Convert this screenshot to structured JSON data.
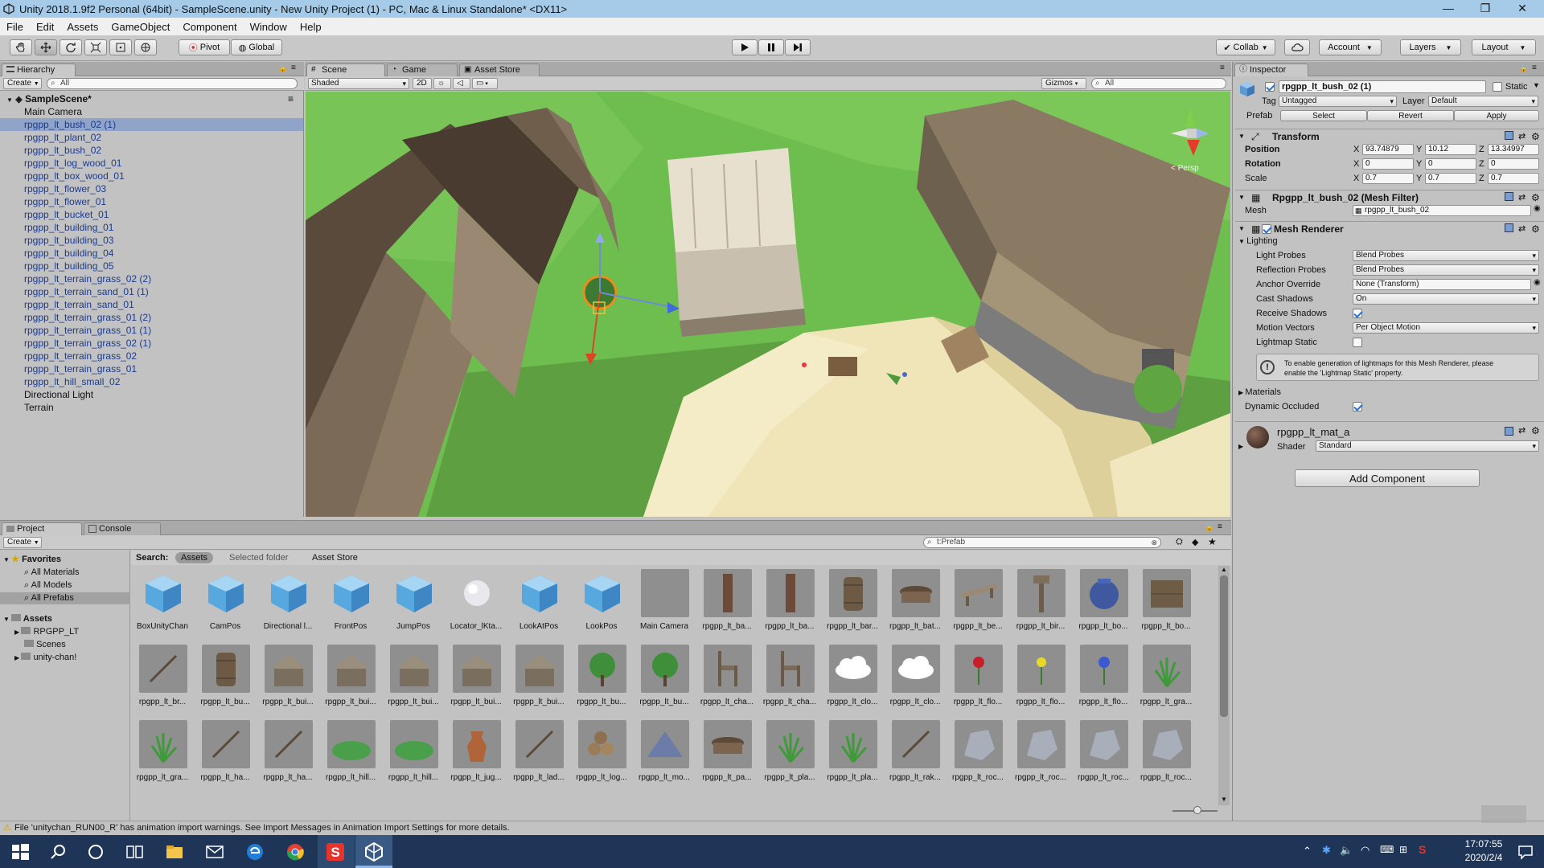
{
  "window": {
    "title": "Unity 2018.1.9f2 Personal (64bit) - SampleScene.unity - New Unity Project (1) - PC, Mac & Linux Standalone* <DX11>",
    "controls": [
      "—",
      "❐",
      "✕"
    ]
  },
  "menu": [
    "File",
    "Edit",
    "Assets",
    "GameObject",
    "Component",
    "Window",
    "Help"
  ],
  "toolbar": {
    "pivot": "Pivot",
    "global": "Global",
    "collab": "Collab",
    "account": "Account",
    "layers": "Layers",
    "layout": "Layout"
  },
  "hierarchy": {
    "tab": "Hierarchy",
    "create": "Create",
    "search": "All",
    "scene": "SampleScene*",
    "items": [
      {
        "name": "Main Camera",
        "prefab": false,
        "selected": false
      },
      {
        "name": "rpgpp_lt_bush_02 (1)",
        "prefab": true,
        "selected": true
      },
      {
        "name": "rpgpp_lt_plant_02",
        "prefab": true,
        "selected": false
      },
      {
        "name": "rpgpp_lt_bush_02",
        "prefab": true,
        "selected": false
      },
      {
        "name": "rpgpp_lt_log_wood_01",
        "prefab": true,
        "selected": false
      },
      {
        "name": "rpgpp_lt_box_wood_01",
        "prefab": true,
        "selected": false
      },
      {
        "name": "rpgpp_lt_flower_03",
        "prefab": true,
        "selected": false
      },
      {
        "name": "rpgpp_lt_flower_01",
        "prefab": true,
        "selected": false
      },
      {
        "name": "rpgpp_lt_bucket_01",
        "prefab": true,
        "selected": false
      },
      {
        "name": "rpgpp_lt_building_01",
        "prefab": true,
        "selected": false
      },
      {
        "name": "rpgpp_lt_building_03",
        "prefab": true,
        "selected": false
      },
      {
        "name": "rpgpp_lt_building_04",
        "prefab": true,
        "selected": false
      },
      {
        "name": "rpgpp_lt_building_05",
        "prefab": true,
        "selected": false
      },
      {
        "name": "rpgpp_lt_terrain_grass_02 (2)",
        "prefab": true,
        "selected": false
      },
      {
        "name": "rpgpp_lt_terrain_sand_01 (1)",
        "prefab": true,
        "selected": false
      },
      {
        "name": "rpgpp_lt_terrain_sand_01",
        "prefab": true,
        "selected": false
      },
      {
        "name": "rpgpp_lt_terrain_grass_01 (2)",
        "prefab": true,
        "selected": false
      },
      {
        "name": "rpgpp_lt_terrain_grass_01 (1)",
        "prefab": true,
        "selected": false
      },
      {
        "name": "rpgpp_lt_terrain_grass_02 (1)",
        "prefab": true,
        "selected": false
      },
      {
        "name": "rpgpp_lt_terrain_grass_02",
        "prefab": true,
        "selected": false
      },
      {
        "name": "rpgpp_lt_terrain_grass_01",
        "prefab": true,
        "selected": false
      },
      {
        "name": "rpgpp_lt_hill_small_02",
        "prefab": true,
        "selected": false
      },
      {
        "name": "Directional Light",
        "prefab": false,
        "selected": false
      },
      {
        "name": "Terrain",
        "prefab": false,
        "selected": false
      }
    ]
  },
  "scene": {
    "tabs": {
      "scene": "Scene",
      "game": "Game",
      "store": "Asset Store"
    },
    "shading": "Shaded",
    "mode2d": "2D",
    "gizmos": "Gizmos",
    "search": "All",
    "persp": "< Persp"
  },
  "inspector": {
    "tab": "Inspector",
    "object_name": "rpgpp_lt_bush_02 (1)",
    "static_label": "Static",
    "tag_label": "Tag",
    "tag_value": "Untagged",
    "layer_label": "Layer",
    "layer_value": "Default",
    "prefab_label": "Prefab",
    "prefab_select": "Select",
    "prefab_revert": "Revert",
    "prefab_apply": "Apply",
    "transform": {
      "title": "Transform",
      "position_label": "Position",
      "rotation_label": "Rotation",
      "scale_label": "Scale",
      "x": "X",
      "y": "Y",
      "z": "Z",
      "position": [
        "93.74879",
        "10.12",
        "13.34997"
      ],
      "rotation": [
        "0",
        "0",
        "0"
      ],
      "scale": [
        "0.7",
        "0.7",
        "0.7"
      ]
    },
    "mesh_filter": {
      "title": "Rpgpp_lt_bush_02 (Mesh Filter)",
      "mesh_label": "Mesh",
      "mesh_value": "rpgpp_lt_bush_02"
    },
    "mesh_renderer": {
      "title": "Mesh Renderer",
      "lighting": "Lighting",
      "light_probes_label": "Light Probes",
      "light_probes": "Blend Probes",
      "reflection_probes_label": "Reflection Probes",
      "reflection_probes": "Blend Probes",
      "anchor_label": "Anchor Override",
      "anchor": "None (Transform)",
      "cast_label": "Cast Shadows",
      "cast": "On",
      "receive_label": "Receive Shadows",
      "receive": true,
      "motion_label": "Motion Vectors",
      "motion": "Per Object Motion",
      "lightmap_label": "Lightmap Static",
      "lightmap": false,
      "info_line1": "To enable generation of lightmaps for this Mesh Renderer, please",
      "info_line2": "enable the 'Lightmap Static' property.",
      "materials_label": "Materials",
      "occluded_label": "Dynamic Occluded",
      "occluded": true
    },
    "material": {
      "name": "rpgpp_lt_mat_a",
      "shader_label": "Shader",
      "shader": "Standard"
    },
    "add_component": "Add Component"
  },
  "project": {
    "tabs": {
      "project": "Project",
      "console": "Console"
    },
    "create": "Create",
    "search": "t:Prefab",
    "search_label": "Search:",
    "scope_assets": "Assets",
    "scope_selected": "Selected folder",
    "scope_store": "Asset Store",
    "favorites": "Favorites",
    "fav_items": [
      "All Materials",
      "All Models",
      "All Prefabs"
    ],
    "assets_root": "Assets",
    "folders": [
      "RPGPP_LT",
      "Scenes",
      "unity-chan!"
    ],
    "items": [
      {
        "label": "BoxUnityChan",
        "kind": "cube"
      },
      {
        "label": "CamPos",
        "kind": "cube"
      },
      {
        "label": "Directional l...",
        "kind": "cube"
      },
      {
        "label": "FrontPos",
        "kind": "cube"
      },
      {
        "label": "JumpPos",
        "kind": "cube"
      },
      {
        "label": "Locator_lKta...",
        "kind": "sphere"
      },
      {
        "label": "LookAtPos",
        "kind": "cube"
      },
      {
        "label": "LookPos",
        "kind": "cube"
      },
      {
        "label": "Main Camera",
        "kind": "blank"
      },
      {
        "label": "rpgpp_lt_ba...",
        "kind": "plank"
      },
      {
        "label": "rpgpp_lt_ba...",
        "kind": "plank"
      },
      {
        "label": "rpgpp_lt_bar...",
        "kind": "barrel"
      },
      {
        "label": "rpgpp_lt_bat...",
        "kind": "tub"
      },
      {
        "label": "rpgpp_lt_be...",
        "kind": "bench"
      },
      {
        "label": "rpgpp_lt_bir...",
        "kind": "post"
      },
      {
        "label": "rpgpp_lt_bo...",
        "kind": "pot"
      },
      {
        "label": "rpgpp_lt_bo...",
        "kind": "crate"
      },
      {
        "label": "rpgpp_lt_br...",
        "kind": "stick"
      },
      {
        "label": "rpgpp_lt_bu...",
        "kind": "barrel"
      },
      {
        "label": "rpgpp_lt_bui...",
        "kind": "house"
      },
      {
        "label": "rpgpp_lt_bui...",
        "kind": "house"
      },
      {
        "label": "rpgpp_lt_bui...",
        "kind": "house"
      },
      {
        "label": "rpgpp_lt_bui...",
        "kind": "house"
      },
      {
        "label": "rpgpp_lt_bui...",
        "kind": "house"
      },
      {
        "label": "rpgpp_lt_bu...",
        "kind": "bush"
      },
      {
        "label": "rpgpp_lt_bu...",
        "kind": "bush"
      },
      {
        "label": "rpgpp_lt_cha...",
        "kind": "chair"
      },
      {
        "label": "rpgpp_lt_cha...",
        "kind": "chair"
      },
      {
        "label": "rpgpp_lt_clo...",
        "kind": "cloud"
      },
      {
        "label": "rpgpp_lt_clo...",
        "kind": "cloud"
      },
      {
        "label": "rpgpp_lt_flo...",
        "kind": "flower-red"
      },
      {
        "label": "rpgpp_lt_flo...",
        "kind": "flower-yellow"
      },
      {
        "label": "rpgpp_lt_flo...",
        "kind": "flower-blue"
      },
      {
        "label": "rpgpp_lt_gra...",
        "kind": "grass"
      },
      {
        "label": "rpgpp_lt_gra...",
        "kind": "grass"
      },
      {
        "label": "rpgpp_lt_ha...",
        "kind": "stick"
      },
      {
        "label": "rpgpp_lt_ha...",
        "kind": "stick"
      },
      {
        "label": "rpgpp_lt_hill...",
        "kind": "hill"
      },
      {
        "label": "rpgpp_lt_hill...",
        "kind": "hill"
      },
      {
        "label": "rpgpp_lt_jug...",
        "kind": "jug"
      },
      {
        "label": "rpgpp_lt_lad...",
        "kind": "stick"
      },
      {
        "label": "rpgpp_lt_log...",
        "kind": "logs"
      },
      {
        "label": "rpgpp_lt_mo...",
        "kind": "mound"
      },
      {
        "label": "rpgpp_lt_pa...",
        "kind": "tub"
      },
      {
        "label": "rpgpp_lt_pla...",
        "kind": "grass"
      },
      {
        "label": "rpgpp_lt_pla...",
        "kind": "grass"
      },
      {
        "label": "rpgpp_lt_rak...",
        "kind": "stick"
      },
      {
        "label": "rpgpp_lt_roc...",
        "kind": "rock"
      },
      {
        "label": "rpgpp_lt_roc...",
        "kind": "rock"
      },
      {
        "label": "rpgpp_lt_roc...",
        "kind": "rock"
      },
      {
        "label": "rpgpp_lt_roc...",
        "kind": "rock"
      }
    ]
  },
  "status": "File 'unitychan_RUN00_R' has animation import warnings. See Import Messages in Animation Import Settings for more details.",
  "taskbar": {
    "time": "17:07:55",
    "date": "2020/2/4"
  },
  "colors": {
    "titlebar": "#a6cbe8",
    "selection": "#8fa4c8",
    "prefab_text": "#1b3a8c",
    "taskbar": "#1e3557",
    "grass": "#6fb84e",
    "sand": "#efe5b8"
  }
}
